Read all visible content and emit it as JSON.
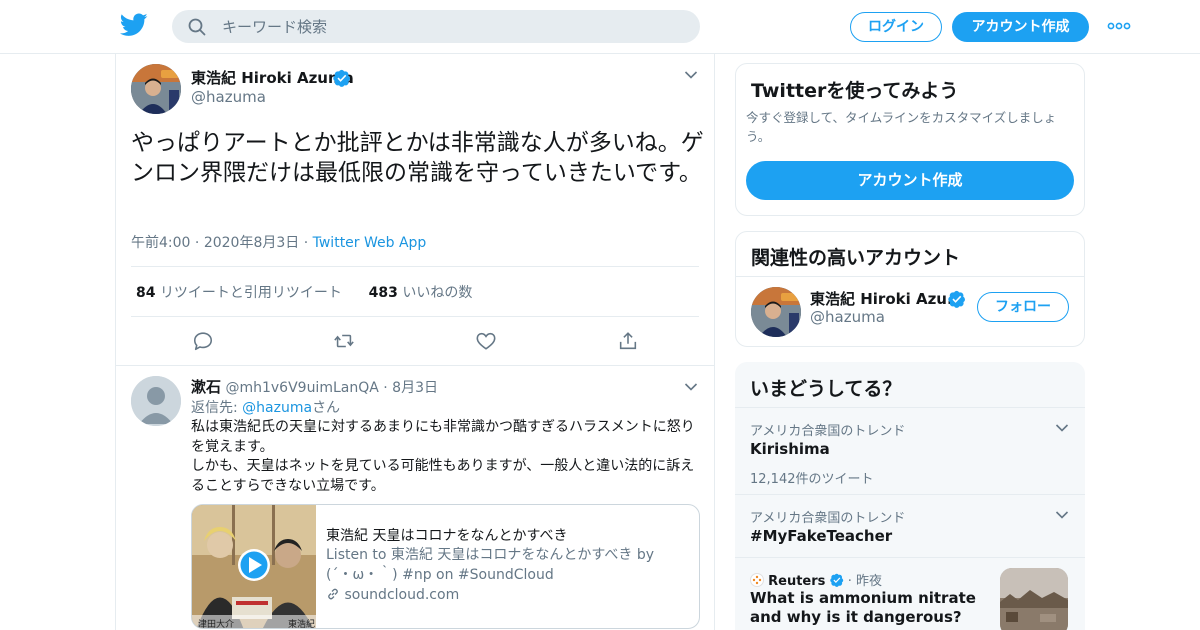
{
  "header": {
    "search_placeholder": "キーワード検索",
    "login_label": "ログイン",
    "signup_label": "アカウント作成"
  },
  "tweet": {
    "author_name": "東浩紀 Hiroki Azuma",
    "author_handle": "@hazuma",
    "text": "やっぱりアートとか批評とかは非常識な人が多いね。ゲンロン界隈だけは最低限の常識を守っていきたいです。",
    "time": "午前4:00",
    "date": "2020年8月3日",
    "source": "Twitter Web App",
    "retweet_count": "84",
    "retweet_label": "リツイートと引用リツイート",
    "like_count": "483",
    "like_label": "いいねの数"
  },
  "reply": {
    "author_name": "漱石",
    "author_handle": "@mh1v6V9uimLanQA",
    "date": "8月3日",
    "reply_to_label": "返信先:",
    "reply_to_handle": "@hazuma",
    "reply_to_suffix": "さん",
    "text_line1": "私は東浩紀氏の天皇に対するあまりにも非常識かつ酷すぎるハラスメントに怒りを覚えます。",
    "text_line2": "しかも、天皇はネットを見ている可能性もありますが、一般人と違い法的に訴えることすらできない立場です。",
    "card": {
      "title": "東浩紀 天皇はコロナをなんとかすべき",
      "description": "Listen to 東浩紀 天皇はコロナをなんとかすべき by (´・ω・｀) #np on #SoundCloud",
      "domain": "soundcloud.com",
      "thumb_caption_left": "津田大介",
      "thumb_caption_right": "東浩紀"
    }
  },
  "sidebar": {
    "try_title": "Twitterを使ってみよう",
    "try_desc": "今すぐ登録して、タイムラインをカスタマイズしましょう。",
    "try_button": "アカウント作成",
    "related_title": "関連性の高いアカウント",
    "related_name": "東浩紀 Hiroki Azu...",
    "related_handle": "@hazuma",
    "follow_label": "フォロー",
    "trends_title": "いまどうしてる？",
    "trends": [
      {
        "context": "アメリカ合衆国のトレンド",
        "title": "Kirishima",
        "count": "12,142件のツイート"
      },
      {
        "context": "アメリカ合衆国のトレンド",
        "title": "#MyFakeTeacher"
      }
    ],
    "news": {
      "source": "Reuters",
      "time": "昨夜",
      "title": "What is ammonium nitrate and why is it dangerous?"
    }
  },
  "colors": {
    "accent": "#1da1f2",
    "link": "#1b95e0",
    "muted": "#657786",
    "border": "#e6ecf0"
  }
}
